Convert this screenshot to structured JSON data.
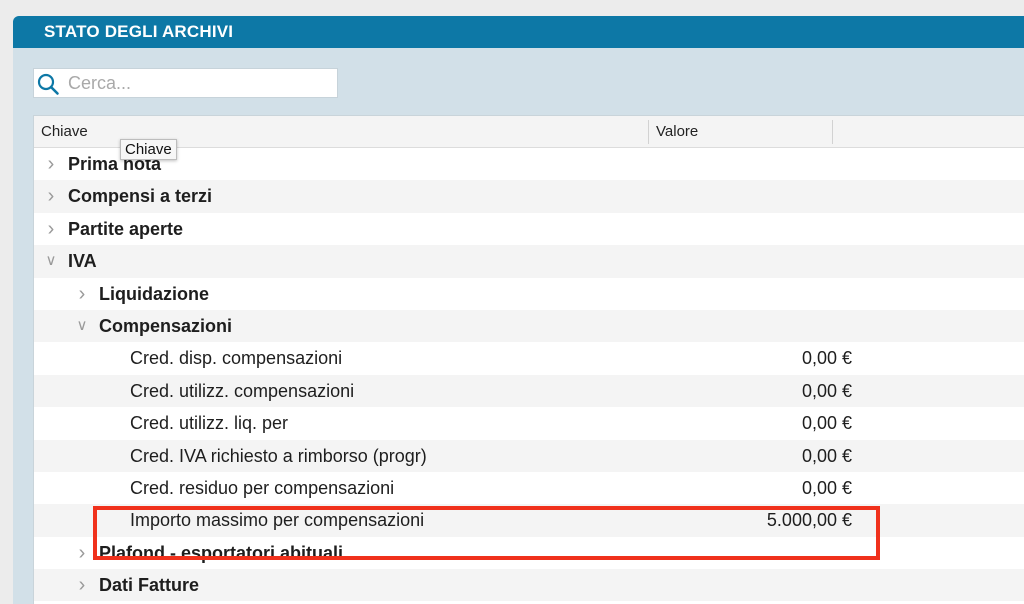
{
  "window": {
    "title": "STATO DEGLI ARCHIVI"
  },
  "search": {
    "placeholder": "Cerca...",
    "value": "",
    "icon": "search-icon"
  },
  "table": {
    "columns": {
      "key": "Chiave",
      "value": "Valore"
    },
    "tooltip": "Chiave",
    "rows": [
      {
        "label": "Prima nota",
        "value": "",
        "expanded": false,
        "group": true
      },
      {
        "label": "Compensi a terzi",
        "value": "",
        "expanded": false,
        "group": true
      },
      {
        "label": "Partite aperte",
        "value": "",
        "expanded": false,
        "group": true
      },
      {
        "label": "IVA",
        "value": "",
        "expanded": true,
        "group": true
      },
      {
        "label": "Liquidazione",
        "value": "",
        "expanded": false,
        "group": true
      },
      {
        "label": "Compensazioni",
        "value": "",
        "expanded": true,
        "group": true
      },
      {
        "label": "Cred. disp. compensazioni",
        "value": "0,00 €",
        "group": false
      },
      {
        "label": "Cred. utilizz. compensazioni",
        "value": "0,00 €",
        "group": false
      },
      {
        "label": "Cred. utilizz. liq. per",
        "value": "0,00 €",
        "group": false
      },
      {
        "label": "Cred. IVA richiesto a rimborso (progr)",
        "value": "0,00 €",
        "group": false
      },
      {
        "label": "Cred. residuo per compensazioni",
        "value": "0,00 €",
        "group": false
      },
      {
        "label": "Importo massimo per compensazioni",
        "value": "5.000,00 €",
        "group": false,
        "highlighted": true
      },
      {
        "label": "Plafond - esportatori abituali",
        "value": "",
        "expanded": false,
        "group": true
      },
      {
        "label": "Dati Fatture",
        "value": "",
        "expanded": false,
        "group": true
      }
    ]
  },
  "colors": {
    "titlebar": "#0d78a6",
    "window_bg": "#d2e0e8",
    "highlight_border": "#f0311c"
  }
}
